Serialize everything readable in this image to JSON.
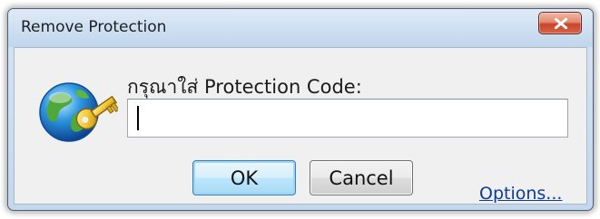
{
  "window": {
    "title": "Remove Protection",
    "close_label": "×"
  },
  "dialog": {
    "prompt": "กรุณาใส่ Protection Code:",
    "code_value": "",
    "ok_label": "OK",
    "cancel_label": "Cancel",
    "options_label": "Options..."
  },
  "icons": {
    "app_icon": "globe-key-icon",
    "close_icon": "close-icon"
  },
  "colors": {
    "title_bar": "#cddff1",
    "close_button": "#c8452a",
    "ok_border": "#3c7fb1",
    "link": "#0b3c9a"
  }
}
